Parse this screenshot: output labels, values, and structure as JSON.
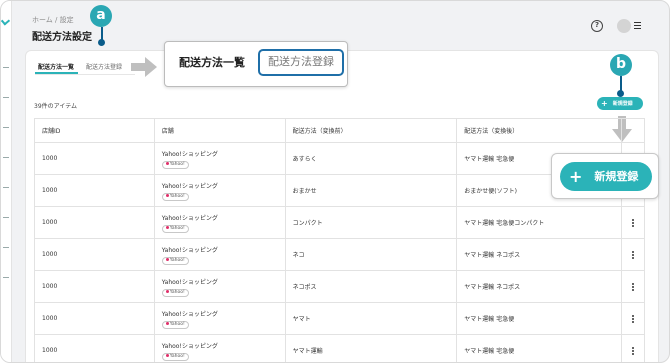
{
  "breadcrumb": "ホーム / 設定",
  "page_title": "配送方法設定",
  "tabs": {
    "list_label": "配送方法一覧",
    "register_label": "配送方法登録"
  },
  "zoom_tabs": {
    "list_label": "配送方法一覧",
    "register_label": "配送方法登録"
  },
  "callouts": {
    "a": "a",
    "b": "b"
  },
  "item_count": "39件のアイテム",
  "new_button_label": "新規登録",
  "zoom_new_button_label": "新規登録",
  "table": {
    "headers": [
      "店舗ID",
      "店舗",
      "配送方法（変換前）",
      "配送方法（変換後）"
    ],
    "badge_label": "Yahoo!",
    "rows": [
      {
        "id": "1000",
        "shop": "Yahoo!ショッピング",
        "before": "あすらく",
        "after": "ヤマト運輸 宅急便"
      },
      {
        "id": "1000",
        "shop": "Yahoo!ショッピング",
        "before": "おまかせ",
        "after": "おまかせ便(ソフト)"
      },
      {
        "id": "1000",
        "shop": "Yahoo!ショッピング",
        "before": "コンパクト",
        "after": "ヤマト運輸 宅急便コンパクト"
      },
      {
        "id": "1000",
        "shop": "Yahoo!ショッピング",
        "before": "ネコ",
        "after": "ヤマト運輸 ネコポス"
      },
      {
        "id": "1000",
        "shop": "Yahoo!ショッピング",
        "before": "ネコポス",
        "after": "ヤマト運輸 ネコポス"
      },
      {
        "id": "1000",
        "shop": "Yahoo!ショッピング",
        "before": "ヤマト",
        "after": "ヤマト運輸 宅急便"
      },
      {
        "id": "1000",
        "shop": "Yahoo!ショッピング",
        "before": "ヤマト運輸",
        "after": "ヤマト運輸 宅急便"
      }
    ]
  },
  "icons": {
    "help": "help-circle-icon",
    "menu": "menu-icon",
    "arrow_right": "arrow-right-icon",
    "arrow_down": "arrow-down-icon",
    "kebab": "kebab-icon"
  },
  "colors": {
    "accent": "#2bb3b8",
    "callout": "#2aa7b3",
    "highlight_border": "#1f6fa8"
  }
}
